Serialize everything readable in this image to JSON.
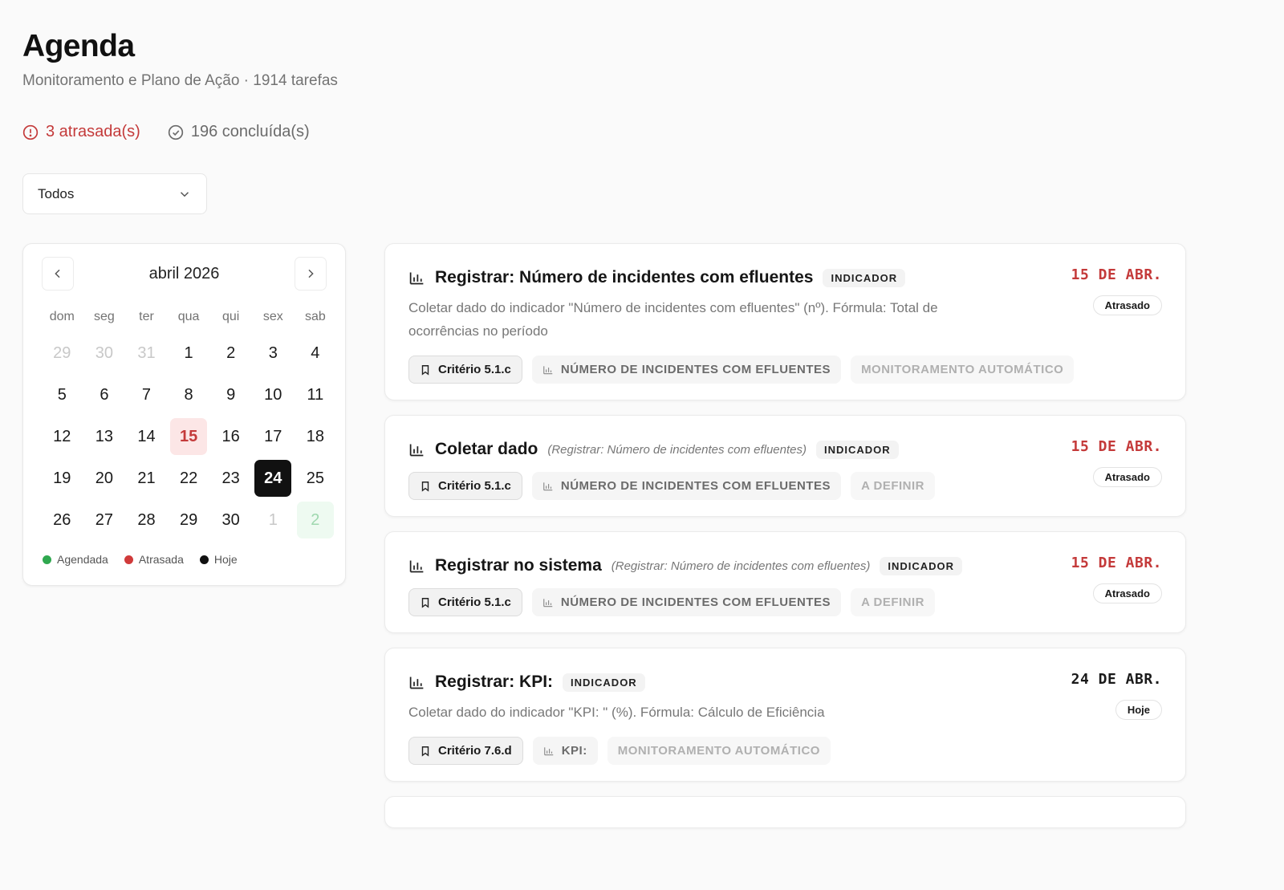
{
  "page": {
    "title": "Agenda",
    "subtitle": "Monitoramento e Plano de Ação · 1914 tarefas"
  },
  "stats": {
    "overdue_label": "3 atrasada(s)",
    "done_label": "196 concluída(s)"
  },
  "filter": {
    "selected": "Todos"
  },
  "calendar": {
    "month_label": "abril 2026",
    "weekdays": [
      "dom",
      "seg",
      "ter",
      "qua",
      "qui",
      "sex",
      "sab"
    ],
    "days": [
      {
        "label": "29",
        "state": "muted"
      },
      {
        "label": "30",
        "state": "muted"
      },
      {
        "label": "31",
        "state": "muted"
      },
      {
        "label": "1",
        "state": "normal"
      },
      {
        "label": "2",
        "state": "normal"
      },
      {
        "label": "3",
        "state": "normal"
      },
      {
        "label": "4",
        "state": "normal"
      },
      {
        "label": "5",
        "state": "normal"
      },
      {
        "label": "6",
        "state": "normal"
      },
      {
        "label": "7",
        "state": "normal"
      },
      {
        "label": "8",
        "state": "normal"
      },
      {
        "label": "9",
        "state": "normal"
      },
      {
        "label": "10",
        "state": "normal"
      },
      {
        "label": "11",
        "state": "normal"
      },
      {
        "label": "12",
        "state": "normal"
      },
      {
        "label": "13",
        "state": "normal"
      },
      {
        "label": "14",
        "state": "normal"
      },
      {
        "label": "15",
        "state": "overdue"
      },
      {
        "label": "16",
        "state": "normal"
      },
      {
        "label": "17",
        "state": "normal"
      },
      {
        "label": "18",
        "state": "normal"
      },
      {
        "label": "19",
        "state": "normal"
      },
      {
        "label": "20",
        "state": "normal"
      },
      {
        "label": "21",
        "state": "normal"
      },
      {
        "label": "22",
        "state": "normal"
      },
      {
        "label": "23",
        "state": "normal"
      },
      {
        "label": "24",
        "state": "today"
      },
      {
        "label": "25",
        "state": "normal"
      },
      {
        "label": "26",
        "state": "normal"
      },
      {
        "label": "27",
        "state": "normal"
      },
      {
        "label": "28",
        "state": "normal"
      },
      {
        "label": "29",
        "state": "normal"
      },
      {
        "label": "30",
        "state": "normal"
      },
      {
        "label": "1",
        "state": "muted"
      },
      {
        "label": "2",
        "state": "scheduled"
      }
    ],
    "legend": [
      {
        "label": "Agendada",
        "color": "#2fa84f"
      },
      {
        "label": "Atrasada",
        "color": "#d03a3a"
      },
      {
        "label": "Hoje",
        "color": "#111111"
      }
    ]
  },
  "tasks": [
    {
      "title": "Registrar: Número de incidentes com efluentes",
      "parent": "",
      "type": "INDICADOR",
      "description": "Coletar dado do indicador \"Número de incidentes com efluentes\" (nº). Fórmula: Total de ocorrências no período",
      "criterion": "Critério 5.1.c",
      "indicator": "NÚMERO DE INCIDENTES COM EFLUENTES",
      "mode": "MONITORAMENTO AUTOMÁTICO",
      "date": "15 DE ABR.",
      "status": "Atrasado",
      "state": "overdue"
    },
    {
      "title": "Coletar dado",
      "parent": "(Registrar: Número de incidentes com efluentes)",
      "type": "INDICADOR",
      "description": "",
      "criterion": "Critério 5.1.c",
      "indicator": "NÚMERO DE INCIDENTES COM EFLUENTES",
      "mode": "A DEFINIR",
      "date": "15 DE ABR.",
      "status": "Atrasado",
      "state": "overdue"
    },
    {
      "title": "Registrar no sistema",
      "parent": "(Registrar: Número de incidentes com efluentes)",
      "type": "INDICADOR",
      "description": "",
      "criterion": "Critério 5.1.c",
      "indicator": "NÚMERO DE INCIDENTES COM EFLUENTES",
      "mode": "A DEFINIR",
      "date": "15 DE ABR.",
      "status": "Atrasado",
      "state": "overdue"
    },
    {
      "title": "Registrar: KPI:",
      "parent": "",
      "type": "INDICADOR",
      "description": "Coletar dado do indicador \"KPI: \" (%). Fórmula: Cálculo de Eficiência",
      "criterion": "Critério 7.6.d",
      "indicator": "KPI:",
      "mode": "MONITORAMENTO AUTOMÁTICO",
      "date": "24 DE ABR.",
      "status": "Hoje",
      "state": "today"
    }
  ]
}
